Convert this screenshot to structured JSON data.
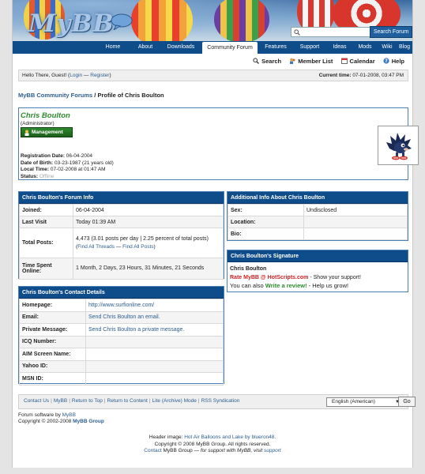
{
  "header": {
    "logo_text": "MyBB",
    "search_placeholder": "",
    "search_button": "Search Forum"
  },
  "nav": {
    "items": [
      "Home",
      "About",
      "Downloads",
      "Community Forum",
      "Features",
      "Support",
      "Ideas",
      "Mods",
      "Wiki",
      "Blog"
    ],
    "active": "Community Forum"
  },
  "quicklinks": [
    "Search",
    "Member List",
    "Calendar",
    "Help"
  ],
  "welcome": {
    "prefix": "Hello There, Guest! (",
    "login": "Login",
    "dash": " — ",
    "register": "Register",
    "suffix": ")",
    "time_label": "Current time:",
    "time_value": "07-01-2008, 03:47 PM"
  },
  "breadcrumb": {
    "forum": "MyBB Community Forums",
    "sep": " / ",
    "page": "Profile of Chris Boulton"
  },
  "profile": {
    "username": "Chris Boulton",
    "usertitle": "(Administrator)",
    "badge": "Management",
    "fields": [
      {
        "label": "Registration Date:",
        "value": "06-04-2004"
      },
      {
        "label": "Date of Birth:",
        "value": "03-23-1987 (21 years old)"
      },
      {
        "label": "Local Time:",
        "value": "07-02-2008 at 01:47 AM"
      },
      {
        "label": "Status:",
        "value": "Offline"
      }
    ]
  },
  "forum_info": {
    "title": "Chris Boulton's Forum Info",
    "joined_label": "Joined:",
    "joined": "06-04-2004",
    "lastvisit_label": "Last Visit",
    "lastvisit": "Today 01:39 AM",
    "posts_label": "Total Posts:",
    "posts": "4,473 (3.01 posts per day | 2.25 percent of total posts)",
    "find_threads": "Find All Threads",
    "find_sep": " — ",
    "find_posts": "Find All Posts",
    "timespent_label": "Time Spent Online:",
    "timespent": "1 Month, 2 Days, 23 Hours, 31 Minutes, 21 Seconds"
  },
  "contact": {
    "title": "Chris Boulton's Contact Details",
    "rows": [
      {
        "label": "Homepage:",
        "value": "http://www.surfionline.com/"
      },
      {
        "label": "Email:",
        "value": "Send Chris Boulton an email."
      },
      {
        "label": "Private Message:",
        "value": "Send Chris Boulton a private message."
      },
      {
        "label": "ICQ Number:",
        "value": ""
      },
      {
        "label": "AIM Screen Name:",
        "value": ""
      },
      {
        "label": "Yahoo ID:",
        "value": ""
      },
      {
        "label": "MSN ID:",
        "value": ""
      }
    ]
  },
  "additional": {
    "title": "Additional Info About Chris Boulton",
    "rows": [
      {
        "label": "Sex:",
        "value": "Undisclosed"
      },
      {
        "label": "Location:",
        "value": ""
      },
      {
        "label": "Bio:",
        "value": ""
      }
    ]
  },
  "signature": {
    "title": "Chris Boulton's Signature",
    "name": "Chris Boulton",
    "line1_link": "Rate MyBB @ HotScripts.com",
    "line1_rest": " - Show your support!",
    "line2_pre": "You can also ",
    "line2_link": "Write a review!",
    "line2_rest": " - Help us grow!"
  },
  "footer": {
    "links": [
      "Contact Us",
      "MyBB",
      "Return to Top",
      "Return to Content",
      "Lite (Archive) Mode",
      "RSS Syndication"
    ],
    "language": "English (American)",
    "go": "Go",
    "powered_pre": "Forum software by ",
    "powered_link": "MyBB",
    "copyright_pre": "Copyright © 2002-2008 ",
    "copyright_link": "MyBB Group",
    "header_image_pre": "Header image: ",
    "header_image_link": "Hot Air Balloons and Lake by blueron48",
    "header_image_post": ".",
    "copy2": "Copyright © 2008 MyBB Group. All rights reserved.",
    "contact_link": "Contact",
    "contact_mid": " MyBB Group — ",
    "contact_em": "for support with MyBB, visit ",
    "support_link": "support"
  }
}
